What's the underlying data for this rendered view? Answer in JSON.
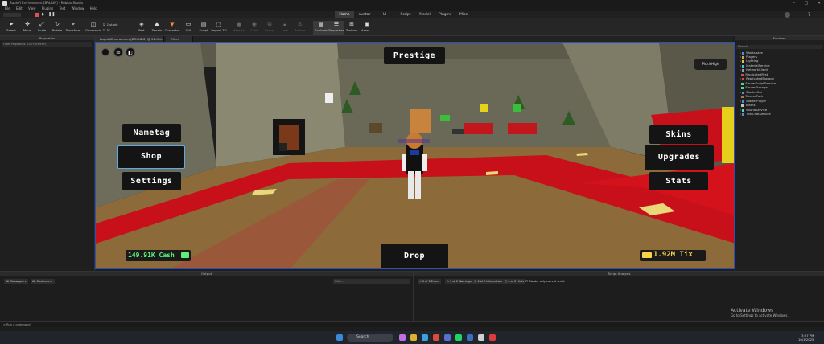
{
  "window": {
    "title": "Baplefi Environment [BALRIN] - Roblox Studio"
  },
  "menu": [
    "File",
    "Edit",
    "View",
    "Plugins",
    "Test",
    "Window",
    "Help"
  ],
  "ribbon_tabs": [
    {
      "label": "Home",
      "active": true
    },
    {
      "label": "Avatar",
      "active": false
    },
    {
      "label": "UI",
      "active": false
    },
    {
      "label": "Script",
      "active": false
    },
    {
      "label": "Model",
      "active": false
    },
    {
      "label": "Plugins",
      "active": false
    },
    {
      "label": "Misc",
      "active": false
    }
  ],
  "toolbar": {
    "tools": [
      "Select",
      "Move",
      "Scale",
      "Rotate",
      "Transform",
      "Geometric"
    ],
    "snap_rotate": "1 studs",
    "snap_move": "5°",
    "insert_tools": [
      "Part",
      "Terrain",
      "Character",
      "GUI",
      "Script",
      "Import 3D"
    ],
    "disabled_tools": [
      "Material",
      "Color",
      "Group",
      "Lock",
      "Anchor"
    ],
    "panel_tools": [
      "Explorer",
      "Properties",
      "Toolbox",
      "Asset..."
    ]
  },
  "left_panel": {
    "title": "Properties",
    "filter_placeholder": "Filter Properties (Ctrl+Shift+P)"
  },
  "doc_tabs": [
    "RagdollEnvironment[BOUNDS] @ 01-Oct-2025 19:2..",
    "Client"
  ],
  "game": {
    "top_button": "Prestige",
    "left_buttons": [
      "Nametag",
      "Shop",
      "Settings"
    ],
    "right_buttons": [
      "Skins",
      "Upgrades",
      "Stats"
    ],
    "bottom_button": "Drop",
    "cash": "149.91K Cash",
    "tix": "1.92M Tix",
    "player_tag": "PickleHigh"
  },
  "explorer": {
    "title": "Explorer",
    "search_placeholder": "Search",
    "items": [
      {
        "label": "Workspace",
        "color": "#4a90d9"
      },
      {
        "label": "Players",
        "color": "#d9a44a"
      },
      {
        "label": "Lighting",
        "color": "#e0c640"
      },
      {
        "label": "MaterialService",
        "color": "#4ac0d9"
      },
      {
        "label": "NetworkClient",
        "color": "#8aa0b0"
      },
      {
        "label": "ReplicatedFirst",
        "color": "#d94a4a"
      },
      {
        "label": "ReplicatedStorage",
        "color": "#d94a4a"
      },
      {
        "label": "ServerScriptService",
        "color": "#4ad98a"
      },
      {
        "label": "ServerStorage",
        "color": "#4ad98a"
      },
      {
        "label": "StarterGui",
        "color": "#6a8ae0"
      },
      {
        "label": "StarterPack",
        "color": "#a07a4a"
      },
      {
        "label": "StarterPlayer",
        "color": "#4a90d9"
      },
      {
        "label": "Teams",
        "color": "#c0c0c0"
      },
      {
        "label": "SoundService",
        "color": "#4ad9c0"
      },
      {
        "label": "TextChatService",
        "color": "#4a90d9"
      }
    ]
  },
  "output": {
    "title": "Output",
    "filter_all_messages": "All Messages",
    "filter_all_contexts": "All Contexts",
    "filter_placeholder": "Filter...",
    "command_placeholder": "Run a command"
  },
  "script_analysis": {
    "title": "Script Analysis",
    "errors": "0 of 0 Errors",
    "warnings": "0 of 0 Warnings",
    "info": "0 of 0 Information",
    "hints": "0 of 0 Hints",
    "checkbox": "Display only current script"
  },
  "activation": {
    "title": "Activate Windows",
    "subtitle": "Go to Settings to activate Windows."
  },
  "taskbar": {
    "search": "Search",
    "time": "3:27 PM",
    "date": "10/1/2025"
  }
}
